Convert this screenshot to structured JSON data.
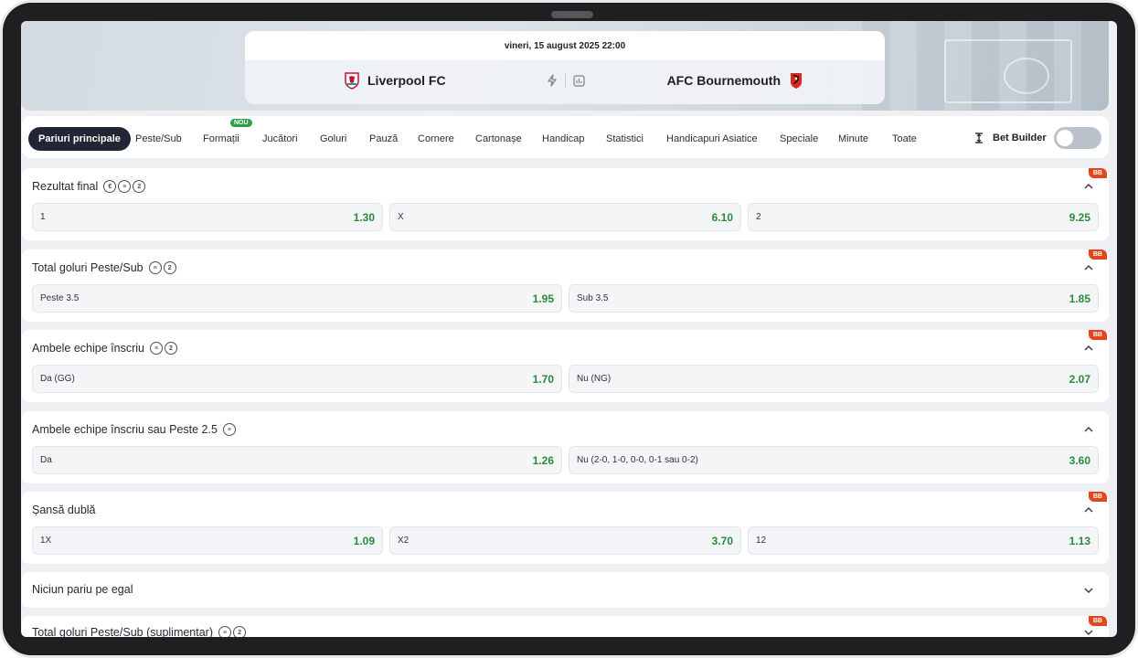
{
  "match": {
    "date": "vineri, 15 august 2025 22:00",
    "home_team": "Liverpool FC",
    "away_team": "AFC Bournemouth"
  },
  "tabs": [
    {
      "label": "Pariuri principale",
      "active": true
    },
    {
      "label": "Peste/Sub"
    },
    {
      "label": "Formații",
      "badge": "NOU"
    },
    {
      "label": "Jucători"
    },
    {
      "label": "Goluri"
    },
    {
      "label": "Pauză"
    },
    {
      "label": "Cornere"
    },
    {
      "label": "Cartonașe"
    },
    {
      "label": "Handicap"
    },
    {
      "label": "Statistici"
    },
    {
      "label": "Handicapuri Asiatice"
    },
    {
      "label": "Speciale"
    },
    {
      "label": "Minute"
    },
    {
      "label": "Toate"
    }
  ],
  "bet_builder": {
    "label": "Bet Builder",
    "enabled": false
  },
  "markets": [
    {
      "title": "Rezultat final",
      "bb": "BB",
      "expanded": true,
      "odds": [
        {
          "label": "1",
          "value": "1.30"
        },
        {
          "label": "X",
          "value": "6.10"
        },
        {
          "label": "2",
          "value": "9.25"
        }
      ]
    },
    {
      "title": "Total goluri Peste/Sub",
      "bb": "BB",
      "expanded": true,
      "odds": [
        {
          "label": "Peste 3.5",
          "value": "1.95"
        },
        {
          "label": "Sub 3.5",
          "value": "1.85"
        }
      ]
    },
    {
      "title": "Ambele echipe înscriu",
      "bb": "BB",
      "expanded": true,
      "odds": [
        {
          "label": "Da (GG)",
          "value": "1.70"
        },
        {
          "label": "Nu (NG)",
          "value": "2.07"
        }
      ]
    },
    {
      "title": "Ambele echipe înscriu sau Peste 2.5",
      "expanded": true,
      "odds": [
        {
          "label": "Da",
          "value": "1.26"
        },
        {
          "label": "Nu (2-0, 1-0, 0-0, 0-1 sau 0-2)",
          "value": "3.60"
        }
      ]
    },
    {
      "title": "Șansă dublă",
      "bb": "BB",
      "expanded": true,
      "odds": [
        {
          "label": "1X",
          "value": "1.09"
        },
        {
          "label": "X2",
          "value": "3.70"
        },
        {
          "label": "12",
          "value": "1.13"
        }
      ]
    },
    {
      "title": "Niciun pariu pe egal",
      "expanded": false,
      "odds": []
    },
    {
      "title": "Total goluri Peste/Sub (suplimentar)",
      "bb": "BB",
      "expanded": false,
      "odds": []
    }
  ],
  "colors": {
    "accent_green": "#2a8a3c",
    "bb_badge": "#e5451b",
    "active_tab": "#202634",
    "nou_badge": "#2ea24a"
  }
}
